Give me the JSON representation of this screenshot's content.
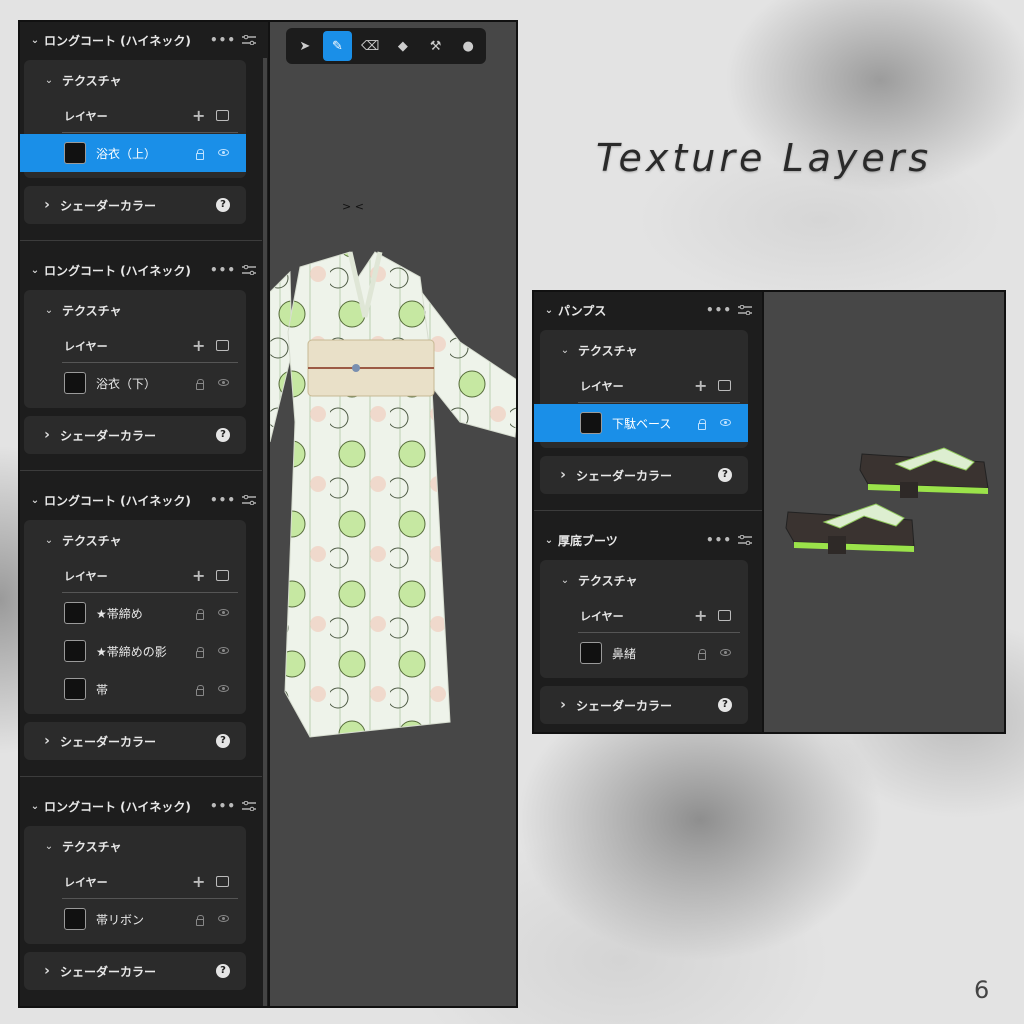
{
  "page": {
    "title": "Texture Layers",
    "page_number": "6"
  },
  "toolbar": {
    "tools": [
      {
        "icon": "select-arrow-icon",
        "glyph": "➤",
        "active": false
      },
      {
        "icon": "brush-icon",
        "glyph": "✎",
        "active": true
      },
      {
        "icon": "eraser-icon",
        "glyph": "⌫",
        "active": false
      },
      {
        "icon": "fill-icon",
        "glyph": "◆",
        "active": false
      },
      {
        "icon": "stamp-icon",
        "glyph": "⚒",
        "active": false
      },
      {
        "icon": "dropper-icon",
        "glyph": "●",
        "active": false
      }
    ]
  },
  "viewport_left": {
    "cursor_glyph": "> <"
  },
  "left_panel": {
    "groups": [
      {
        "material": "ロングコート (ハイネック)",
        "texture_label": "テクスチャ",
        "layer_label": "レイヤー",
        "layers": [
          {
            "name": "浴衣（上）",
            "selected": true
          }
        ],
        "shader_label": "シェーダーカラー"
      },
      {
        "material": "ロングコート (ハイネック)",
        "texture_label": "テクスチャ",
        "layer_label": "レイヤー",
        "layers": [
          {
            "name": "浴衣（下）",
            "selected": false
          }
        ],
        "shader_label": "シェーダーカラー"
      },
      {
        "material": "ロングコート (ハイネック)",
        "texture_label": "テクスチャ",
        "layer_label": "レイヤー",
        "layers": [
          {
            "name": "★帯締め",
            "selected": false
          },
          {
            "name": "★帯締めの影",
            "selected": false
          },
          {
            "name": "帯",
            "selected": false
          }
        ],
        "shader_label": "シェーダーカラー"
      },
      {
        "material": "ロングコート (ハイネック)",
        "texture_label": "テクスチャ",
        "layer_label": "レイヤー",
        "layers": [
          {
            "name": "帯リボン",
            "selected": false
          }
        ],
        "shader_label": "シェーダーカラー"
      }
    ]
  },
  "right_panel": {
    "groups": [
      {
        "material": "パンプス",
        "texture_label": "テクスチャ",
        "layer_label": "レイヤー",
        "layers": [
          {
            "name": "下駄ベース",
            "selected": true
          }
        ],
        "shader_label": "シェーダーカラー"
      },
      {
        "material": "厚底ブーツ",
        "texture_label": "テクスチャ",
        "layer_label": "レイヤー",
        "layers": [
          {
            "name": "鼻緒",
            "selected": false
          }
        ],
        "shader_label": "シェーダーカラー"
      }
    ]
  },
  "colors": {
    "accent": "#1a8fe8",
    "panel": "#1d1d1d",
    "card": "#2b2b2b",
    "viewport": "#474747"
  }
}
